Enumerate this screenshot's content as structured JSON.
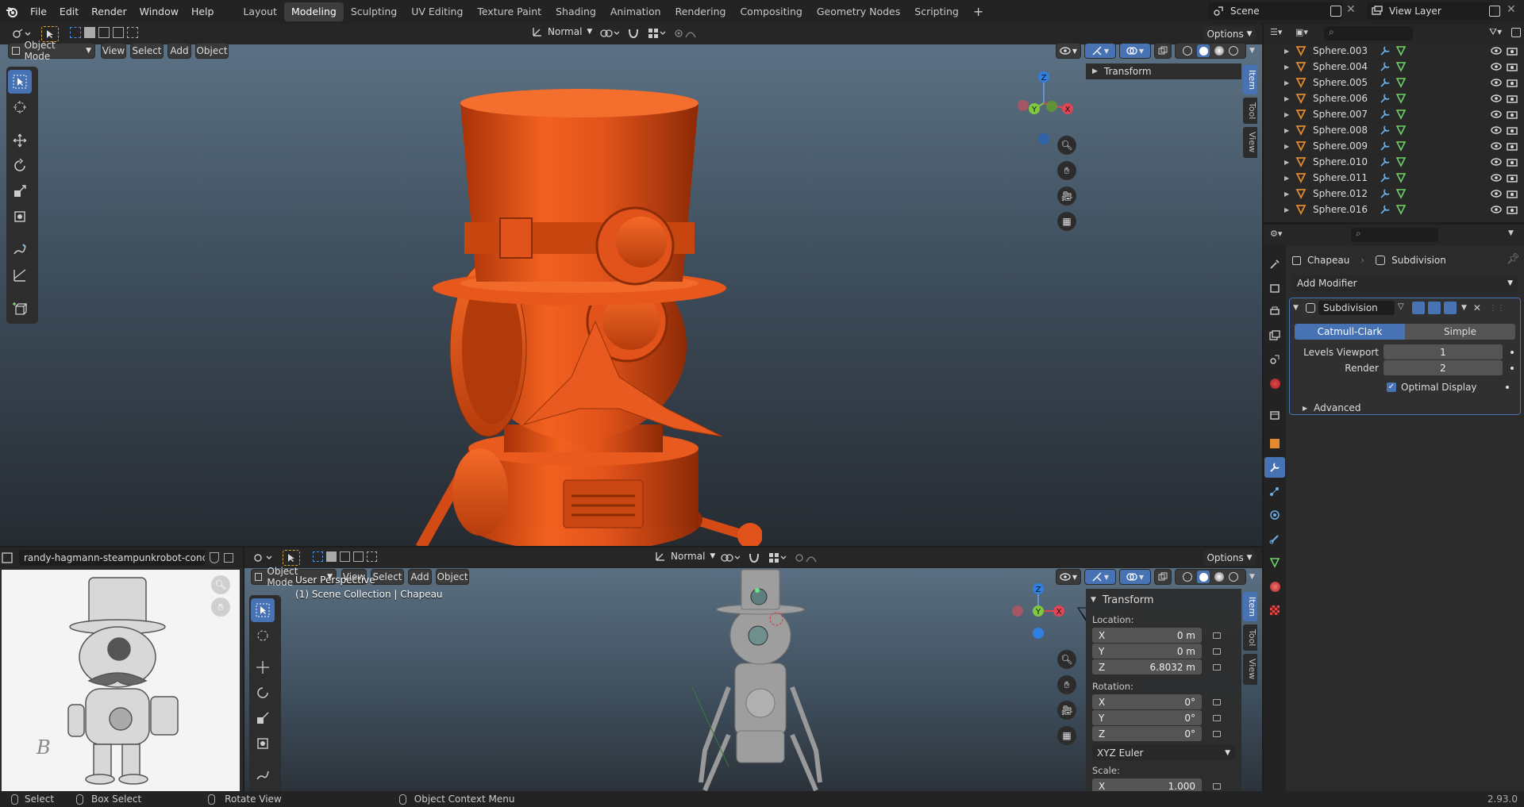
{
  "topbar": {
    "menu": [
      "File",
      "Edit",
      "Render",
      "Window",
      "Help"
    ],
    "workspaces": [
      "Layout",
      "Modeling",
      "Sculpting",
      "UV Editing",
      "Texture Paint",
      "Shading",
      "Animation",
      "Rendering",
      "Compositing",
      "Geometry Nodes",
      "Scripting"
    ],
    "active_workspace": "Modeling",
    "scene": "Scene",
    "view_layer": "View Layer"
  },
  "viewport_top": {
    "mode": "Object Mode",
    "menus": [
      "View",
      "Select",
      "Add",
      "Object"
    ],
    "orientation": "Normal",
    "options": "Options",
    "sidebar_panel": "Transform",
    "tabs": [
      "Item",
      "Tool",
      "View"
    ],
    "gizmo": {
      "x": "X",
      "y": "Y",
      "z": "Z"
    }
  },
  "image_editor": {
    "filename": "randy-hagmann-steampunkrobot-concepts.jpg",
    "signature": "B"
  },
  "viewport_bottom": {
    "mode": "Object Mode",
    "menus": [
      "View",
      "Select",
      "Add",
      "Object"
    ],
    "orientation": "Normal",
    "options": "Options",
    "perspective": "User Perspective",
    "collection": "(1) Scene Collection | Chapeau",
    "transform": {
      "title": "Transform",
      "location_label": "Location:",
      "location": [
        {
          "axis": "X",
          "value": "0 m"
        },
        {
          "axis": "Y",
          "value": "0 m"
        },
        {
          "axis": "Z",
          "value": "6.8032 m"
        }
      ],
      "rotation_label": "Rotation:",
      "rotation": [
        {
          "axis": "X",
          "value": "0°"
        },
        {
          "axis": "Y",
          "value": "0°"
        },
        {
          "axis": "Z",
          "value": "0°"
        }
      ],
      "rotation_mode": "XYZ Euler",
      "scale_label": "Scale:",
      "scale": [
        {
          "axis": "X",
          "value": "1.000"
        }
      ]
    },
    "tabs": [
      "Item",
      "Tool",
      "View"
    ],
    "gizmo": {
      "x": "X",
      "y": "Y",
      "z": "Z"
    }
  },
  "outliner": {
    "items": [
      "Sphere.003",
      "Sphere.004",
      "Sphere.005",
      "Sphere.006",
      "Sphere.007",
      "Sphere.008",
      "Sphere.009",
      "Sphere.010",
      "Sphere.011",
      "Sphere.012",
      "Sphere.016"
    ]
  },
  "properties": {
    "object": "Chapeau",
    "modifier_crumb": "Subdivision",
    "add_modifier": "Add Modifier",
    "modifier_name": "Subdivision",
    "catmull": "Catmull-Clark",
    "simple": "Simple",
    "levels_viewport_label": "Levels Viewport",
    "levels_viewport": "1",
    "render_label": "Render",
    "render": "2",
    "optimal_display": "Optimal Display",
    "advanced": "Advanced"
  },
  "statusbar": {
    "select": "Select",
    "box_select": "Box Select",
    "rotate": "Rotate View",
    "context": "Object Context Menu",
    "version": "2.93.0"
  },
  "colors": {
    "accent": "#4772b3",
    "model": "#e2531b",
    "outliner_icon": "#e0892e"
  }
}
